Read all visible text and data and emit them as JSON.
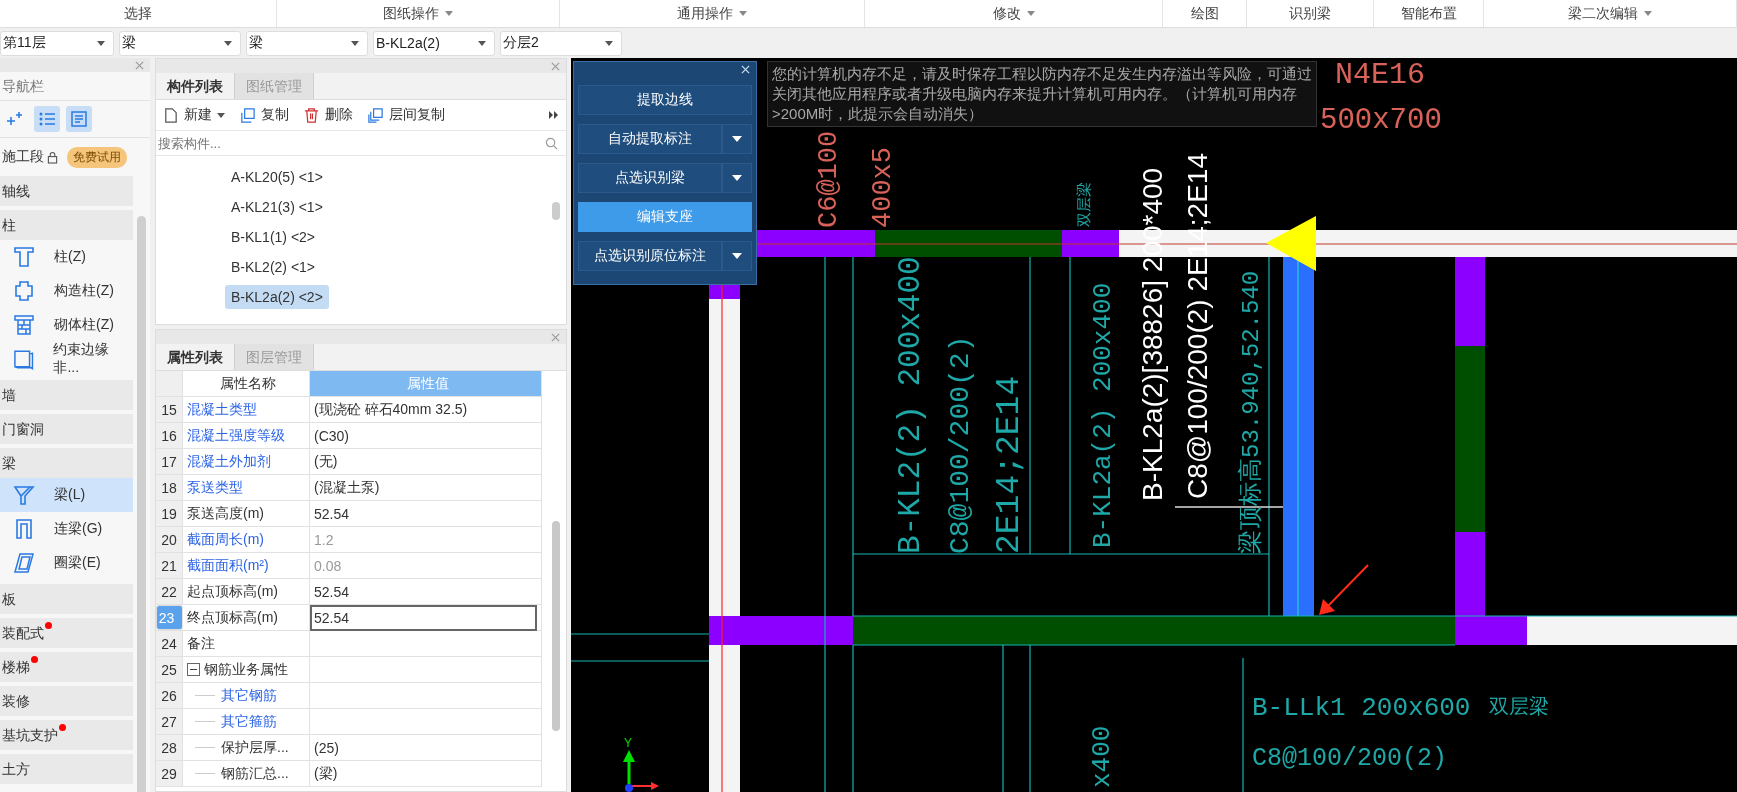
{
  "ribbon": [
    {
      "label": "选择",
      "dropdown": false
    },
    {
      "label": "图纸操作",
      "dropdown": true
    },
    {
      "label": "通用操作",
      "dropdown": true
    },
    {
      "label": "修改",
      "dropdown": true
    },
    {
      "label": "绘图",
      "dropdown": false
    },
    {
      "label": "识别梁",
      "dropdown": false
    },
    {
      "label": "智能布置",
      "dropdown": false
    },
    {
      "label": "梁二次编辑",
      "dropdown": true
    }
  ],
  "selectors": [
    {
      "value": "第11层"
    },
    {
      "value": "梁"
    },
    {
      "value": "梁"
    },
    {
      "value": "B-KL2a(2)"
    },
    {
      "value": "分层2"
    }
  ],
  "navigator": {
    "title": "导航栏",
    "view_buttons": [
      {
        "kind": "add",
        "selected": false
      },
      {
        "kind": "list",
        "selected": true
      },
      {
        "kind": "form",
        "selected": true
      }
    ],
    "stage": {
      "label": "施工段",
      "badge": "免费试用"
    },
    "groups": [
      {
        "label": "轴线",
        "notice": false
      },
      {
        "label": "柱",
        "notice": false,
        "children": [
          {
            "label": "柱(Z)",
            "kind": "column",
            "selected": false
          },
          {
            "label": "构造柱(Z)",
            "kind": "constructional-column",
            "selected": false
          },
          {
            "label": "砌体柱(Z)",
            "kind": "masonry-column",
            "selected": false
          },
          {
            "label": "约束边缘非...",
            "kind": "edge-member",
            "selected": false
          }
        ]
      },
      {
        "label": "墙",
        "notice": false
      },
      {
        "label": "门窗洞",
        "notice": false
      },
      {
        "label": "梁",
        "notice": false,
        "children": [
          {
            "label": "梁(L)",
            "kind": "beam",
            "selected": true
          },
          {
            "label": "连梁(G)",
            "kind": "coupling-beam",
            "selected": false
          },
          {
            "label": "圈梁(E)",
            "kind": "ring-beam",
            "selected": false
          }
        ]
      },
      {
        "label": "板",
        "notice": false
      },
      {
        "label": "装配式",
        "notice": true
      },
      {
        "label": "楼梯",
        "notice": true
      },
      {
        "label": "装修",
        "notice": false
      },
      {
        "label": "基坑支护",
        "notice": true
      },
      {
        "label": "土方",
        "notice": false
      }
    ]
  },
  "components": {
    "tabs": [
      {
        "label": "构件列表",
        "selected": true
      },
      {
        "label": "图纸管理",
        "selected": false
      }
    ],
    "toolbar": [
      {
        "label": "新建",
        "kind": "new",
        "dropdown": true
      },
      {
        "label": "复制",
        "kind": "copy",
        "dropdown": false
      },
      {
        "label": "删除",
        "kind": "delete",
        "dropdown": false
      },
      {
        "label": "层间复制",
        "kind": "floor-copy",
        "dropdown": false
      }
    ],
    "search": {
      "placeholder": "搜索构件..."
    },
    "items": [
      {
        "label": "A-KL20(5) <1>",
        "selected": false
      },
      {
        "label": "A-KL21(3) <1>",
        "selected": false
      },
      {
        "label": "B-KL1(1) <2>",
        "selected": false
      },
      {
        "label": "B-KL2(2) <1>",
        "selected": false
      },
      {
        "label": "B-KL2a(2) <2>",
        "selected": true
      }
    ]
  },
  "properties": {
    "tabs": [
      {
        "label": "属性列表",
        "selected": true
      },
      {
        "label": "图层管理",
        "selected": false
      }
    ],
    "columns": [
      "属性名称",
      "属性值"
    ],
    "rows": [
      {
        "num": "15",
        "name": "混凝土类型",
        "value": "(现浇砼 碎石40mm 32.5)",
        "public": true,
        "disabled": false,
        "selected": false
      },
      {
        "num": "16",
        "name": "混凝土强度等级",
        "value": "(C30)",
        "public": true,
        "disabled": false,
        "selected": false
      },
      {
        "num": "17",
        "name": "混凝土外加剂",
        "value": "(无)",
        "public": true,
        "disabled": false,
        "selected": false
      },
      {
        "num": "18",
        "name": "泵送类型",
        "value": "(混凝土泵)",
        "public": true,
        "disabled": false,
        "selected": false
      },
      {
        "num": "19",
        "name": "泵送高度(m)",
        "value": "52.54",
        "public": false,
        "disabled": false,
        "selected": false
      },
      {
        "num": "20",
        "name": "截面周长(m)",
        "value": "1.2",
        "public": true,
        "disabled": true,
        "selected": false
      },
      {
        "num": "21",
        "name": "截面面积(m²)",
        "value": "0.08",
        "public": true,
        "disabled": true,
        "selected": false
      },
      {
        "num": "22",
        "name": "起点顶标高(m)",
        "value": "52.54",
        "public": false,
        "disabled": false,
        "selected": false
      },
      {
        "num": "23",
        "name": "终点顶标高(m)",
        "value": "52.54",
        "public": false,
        "disabled": false,
        "selected": true
      },
      {
        "num": "24",
        "name": "备注",
        "public": false,
        "disabled": false,
        "selected": false
      },
      {
        "num": "25",
        "name": "钢筋业务属性",
        "public": false,
        "disabled": false,
        "selected": false,
        "expanded": true,
        "children": [
          {
            "num": "26",
            "name": "其它钢筋",
            "public": true,
            "disabled": false,
            "selected": false
          },
          {
            "num": "27",
            "name": "其它箍筋",
            "public": true,
            "disabled": false,
            "selected": false
          },
          {
            "num": "28",
            "name": "保护层厚...",
            "value": "(25)",
            "public": false,
            "disabled": false,
            "selected": false
          },
          {
            "num": "29",
            "name": "钢筋汇总...",
            "value": "(梁)",
            "public": false,
            "disabled": false,
            "selected": false
          }
        ]
      }
    ]
  },
  "recognition_panel": {
    "buttons": [
      {
        "label": "提取边线",
        "split": false,
        "selected": false
      },
      {
        "label": "自动提取标注",
        "split": true,
        "selected": false
      },
      {
        "label": "点选识别梁",
        "split": true,
        "selected": false
      },
      {
        "label": "编辑支座",
        "split": false,
        "selected": true
      },
      {
        "label": "点选识别原位标注",
        "split": true,
        "selected": false
      }
    ]
  },
  "memory_notice": "您的计算机内存不足，请及时保存工程以防内存不足发生内存溢出等风险，可通过关闭其他应用程序或者升级电脑内存来提升计算机可用内存。（计算机可用内存>200M时，此提示会自动消失）",
  "drawing": {
    "labels": [
      {
        "text": "C6@100",
        "color": "#d9625a"
      },
      {
        "text": "400x5",
        "color": "#d9625a"
      },
      {
        "text": "N4E16",
        "color": "#d9625a"
      },
      {
        "text": "500x700",
        "color": "#d9625a"
      },
      {
        "text": "双层梁",
        "color": "#1fa8a8"
      },
      {
        "text": "B-KL2(2) 200x400",
        "color": "#1fa8a8"
      },
      {
        "text": "C8@100/200(2)",
        "color": "#1fa8a8"
      },
      {
        "text": "2E14;2E14",
        "color": "#1fa8a8"
      },
      {
        "text": "B-KL2a(2) 200x400",
        "color": "#1fa8a8"
      },
      {
        "text": "梁顶标高53.940,52.540",
        "color": "#1fa8a8"
      },
      {
        "text": "B-KL2a(2)[38826] 200*400",
        "color": "#ffffff"
      },
      {
        "text": "C8@100/200(2) 2E14;2E14",
        "color": "#ffffff"
      },
      {
        "text": "B-LLk1 200x600",
        "color": "#1fa8a8"
      },
      {
        "text": "双层梁",
        "color": "#1fa8a8"
      },
      {
        "text": "C8@100/200(2)",
        "color": "#1fa8a8"
      },
      {
        "text": "x400",
        "color": "#1fa8a8"
      }
    ],
    "axis_label": "Y"
  }
}
